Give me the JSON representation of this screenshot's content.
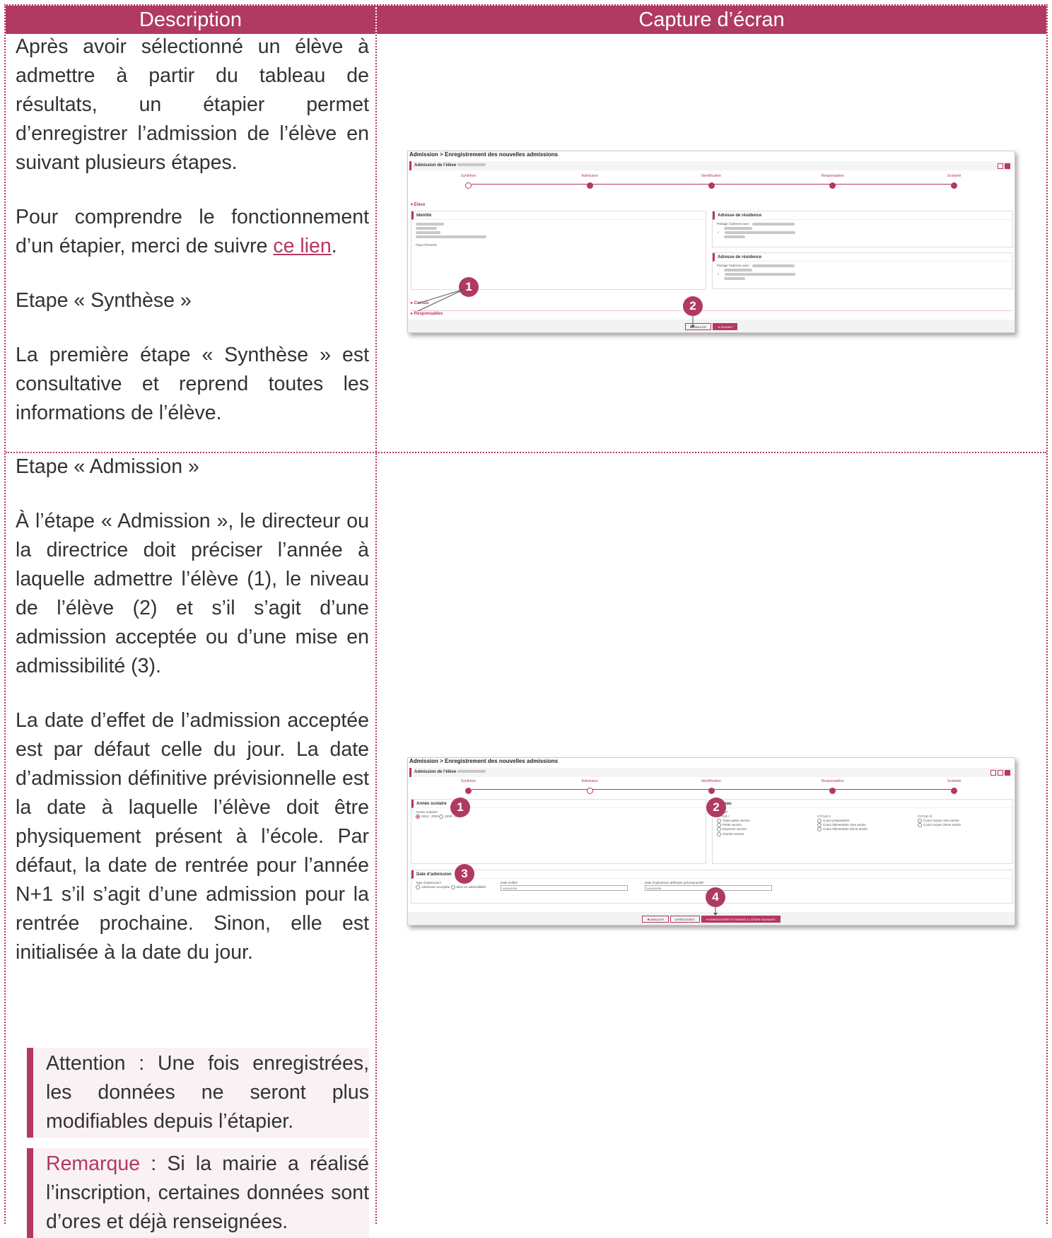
{
  "header": {
    "description": "Description",
    "screenshot": "Capture d’écran"
  },
  "row1": {
    "p1": "Après avoir sélectionné un élève à admettre à partir du tableau de résultats, un étapier permet d’enregistrer l’admission de l’élève en suivant plusieurs étapes.",
    "p2_before": "Pour comprendre le fonctionnement d’un étapier, merci de suivre ",
    "p2_link": "ce lien",
    "p2_after": ".",
    "h": "Etape « Synthèse »",
    "p3": "La première étape « Synthèse » est consultative et reprend toutes les informations de l’élève."
  },
  "row2": {
    "h": "Etape « Admission »",
    "p1": "À l’étape « Admission », le directeur ou la directrice doit préciser l’année à laquelle admettre l’élève (1), le niveau de l’élève (2) et s’il s’agit d’une admission acceptée ou d’une mise en admissibilité (3).",
    "p2": "La date d’effet de l’admission acceptée est par défaut celle du jour. La date d’admission définitive prévisionnelle est la date à laquelle l’élève doit être physiquement présent à l’école. Par défaut, la date de rentrée pour l’année N+1 s’il s’agit d’une admission pour la rentrée prochaine. Sinon, elle est initialisée à la date du jour.",
    "attention_label": "Attention",
    "attention_text": " : Une fois enregistrées, les données ne seront plus modifiables depuis l’étapier.",
    "remark_label": "Remarque",
    "remark_text": " : Si la mairie a réalisé l’inscription, certaines données sont d’ores et déjà renseignées."
  },
  "shot1": {
    "breadcrumb": "Admission > Enregistrement des nouvelles admissions",
    "title": "Admission de l’élève",
    "steps": [
      "Synthèse",
      "Admission",
      "Identification",
      "Responsables",
      "Scolarité"
    ],
    "section_eleve": "▾ Élève",
    "identite": "Identité",
    "pays": "Pays FRANCE",
    "adresse1": "Adresse de résidence",
    "adresse2": "Adresse de résidence",
    "partage": "Partage l’adresse avec :",
    "cursus": "▸ Cursus",
    "responsables": "▸ Responsables",
    "btn_annuler": "✖ ANNULER",
    "btn_suivant": "➜ SUIVANT",
    "badge1": "1",
    "badge2": "2"
  },
  "shot2": {
    "breadcrumb": "Admission > Enregistrement des nouvelles admissions",
    "title": "Admission de l’élève",
    "steps": [
      "Synthèse",
      "Admission",
      "Identification",
      "Responsables",
      "Scolarité"
    ],
    "annee_title": "Année scolaire",
    "annee_label": "Année scolaire*",
    "annee_opt1": "2024 - 2025",
    "annee_opt2": "2025 - 2026",
    "niveau_title": "Niveau",
    "niveau_label": "Niveau*",
    "cycle1": "CYCLE I",
    "cycle1_opts": [
      "Toute petite section",
      "Petite section",
      "Moyenne section",
      "Grande section"
    ],
    "cycle2": "CYCLE II",
    "cycle2_opts": [
      "Cours préparatoire",
      "Cours élémentaire 1ère année",
      "Cours élémentaire 2ème année"
    ],
    "cycle3": "CYCLE III",
    "cycle3_opts": [
      "Cours moyen 1ère année",
      "Cours moyen 2ème année"
    ],
    "date_title": "Date d’admission",
    "type_label": "Type d’admission*",
    "type_opt1": "Admission acceptée",
    "type_opt2": "Mise en admissibilité",
    "effet_label": "Date d’effet*",
    "effet_value": "04/04/2025",
    "def_label": "Date d’admission définitive prévisionnelle*",
    "def_value": "04/04/2025",
    "btn_annuler": "✖ ANNULER",
    "btn_precedent": "◂ PRÉCÉDENT",
    "btn_save": "➜ ENREGISTRER ET PASSER À L’ÉTAPE SUIVANTE",
    "badge1": "1",
    "badge2": "2",
    "badge3": "3",
    "badge4": "4"
  }
}
